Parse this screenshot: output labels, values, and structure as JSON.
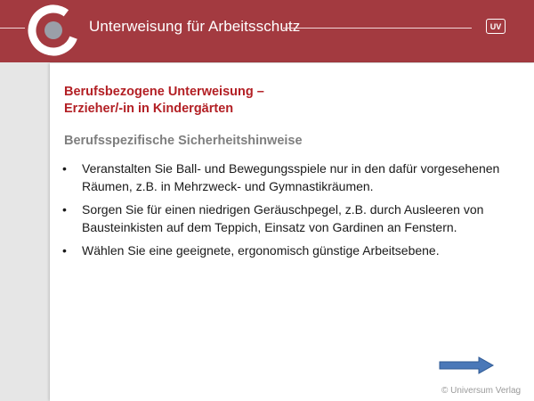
{
  "header": {
    "title": "Unterweisung für Arbeitsschutz",
    "badge": "UV",
    "logo_icon": "ring-logo-icon"
  },
  "slide": {
    "title_line1": "Berufsbezogene Unterweisung –",
    "title_line2": "Erzieher/-in in Kindergärten",
    "subtitle": "Berufsspezifische Sicherheitshinweise",
    "bullets": [
      "Veranstalten Sie Ball- und Bewegungsspiele nur in den dafür vorgesehenen Räumen, z.B. in Mehrzweck- und Gymnastikräumen.",
      "Sorgen Sie für einen niedrigen Geräuschpegel, z.B. durch Ausleeren von Bausteinkisten auf dem Teppich, Einsatz von Gardinen an Fenstern.",
      "Wählen Sie eine geeignete, ergonomisch günstige Arbeitsebene."
    ]
  },
  "footer": {
    "copyright": "© Universum Verlag",
    "next_icon": "arrow-right-icon"
  },
  "colors": {
    "header_bg": "#a33a40",
    "title_red": "#b32025",
    "subtitle_gray": "#7f7f7f",
    "arrow_blue": "#4a78b8"
  }
}
